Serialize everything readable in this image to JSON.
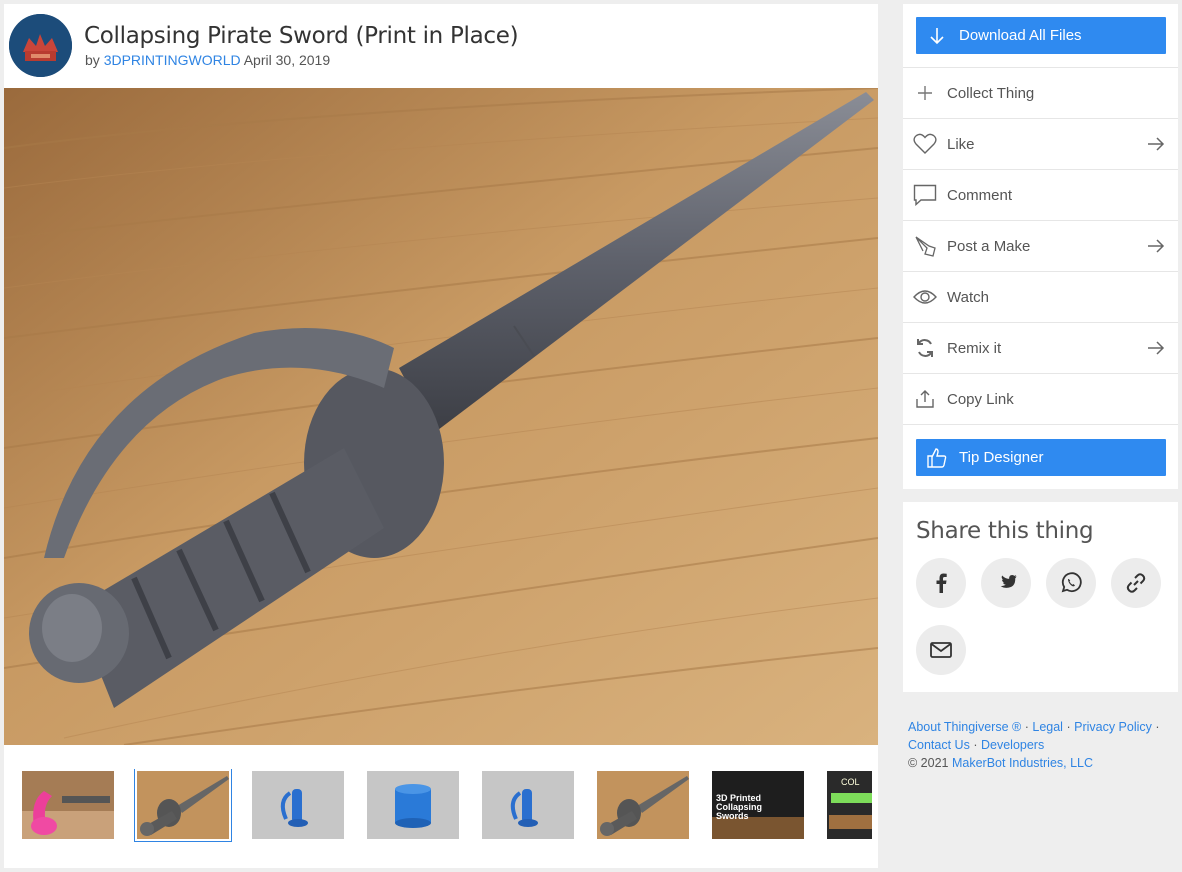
{
  "thing": {
    "title": "Collapsing Pirate Sword (Print in Place)",
    "by": "by",
    "author": "3DPRINTINGWORLD",
    "date": "April 30, 2019"
  },
  "thumbnails": [
    {
      "label": "pink sword photo"
    },
    {
      "label": "sword on wood photo"
    },
    {
      "label": "blue handle render"
    },
    {
      "label": "blue cylinder render"
    },
    {
      "label": "blue handle render 2"
    },
    {
      "label": "sword photo 2"
    },
    {
      "label": "3D Printed Collapsing Swords",
      "line1": "3D Printed",
      "line2": "Collapsing",
      "line3": "Swords"
    },
    {
      "label": "COL video thumbnail",
      "text": "COL"
    }
  ],
  "actions": {
    "download": "Download All Files",
    "collect": "Collect Thing",
    "like": "Like",
    "comment": "Comment",
    "post_make": "Post a Make",
    "watch": "Watch",
    "remix": "Remix it",
    "copy_link": "Copy Link",
    "tip": "Tip Designer"
  },
  "share": {
    "title": "Share this thing"
  },
  "footer": {
    "about": "About Thingiverse",
    "reg": "®",
    "legal": "Legal",
    "privacy": "Privacy Policy",
    "contact": "Contact Us",
    "developers": "Developers",
    "copyright": "© 2021",
    "company": "MakerBot Industries, LLC",
    "sep": "·"
  },
  "colors": {
    "accent": "#2f8af0",
    "link": "#2f84e3"
  }
}
